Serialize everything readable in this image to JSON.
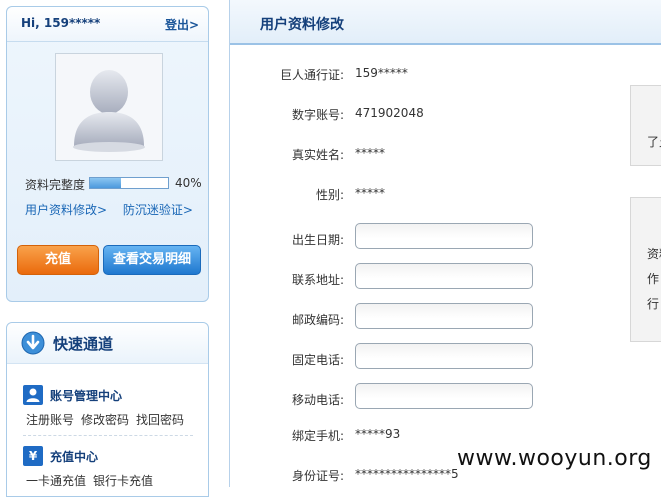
{
  "user_panel": {
    "greeting": "Hi, 159*****",
    "logout": "登出>",
    "completeness_label": "资料完整度",
    "completeness_percent": "40%",
    "completeness_fraction": 0.4,
    "link_edit_profile": "用户资料修改>",
    "link_anti_addiction": "防沉迷验证>",
    "btn_recharge": "充值",
    "btn_view_transactions": "查看交易明细"
  },
  "quick_panel": {
    "title": "快速通道",
    "sections": [
      {
        "icon": "user-icon",
        "title": "账号管理中心",
        "links": [
          "注册账号",
          "修改密码",
          "找回密码"
        ]
      },
      {
        "icon": "yen-icon",
        "icon_glyph": "¥",
        "title": "充值中心",
        "links": [
          "一卡通充值",
          "银行卡充值"
        ]
      }
    ]
  },
  "main": {
    "title": "用户资料修改",
    "fields": [
      {
        "label": "巨人通行证:",
        "value": "159*****"
      },
      {
        "label": "数字账号:",
        "value": "471902048"
      },
      {
        "label": "真实姓名:",
        "value": "*****"
      },
      {
        "label": "性别:",
        "value": "*****"
      },
      {
        "label": "出生日期:",
        "input": ""
      },
      {
        "label": "联系地址:",
        "input": ""
      },
      {
        "label": "邮政编码:",
        "input": ""
      },
      {
        "label": "固定电话:",
        "input": ""
      },
      {
        "label": "移动电话:",
        "input": ""
      },
      {
        "label": "绑定手机:",
        "value": "*****93"
      },
      {
        "label": "身份证号:",
        "value": "****************5"
      }
    ],
    "side_box_1": [
      "了允"
    ],
    "side_box_2": [
      "资料",
      "作",
      "行"
    ]
  },
  "watermark": "www.wooyun.org",
  "colors": {
    "accent_blue": "#1f78cf",
    "accent_orange": "#ea6a0c",
    "heading_blue": "#15407b"
  }
}
